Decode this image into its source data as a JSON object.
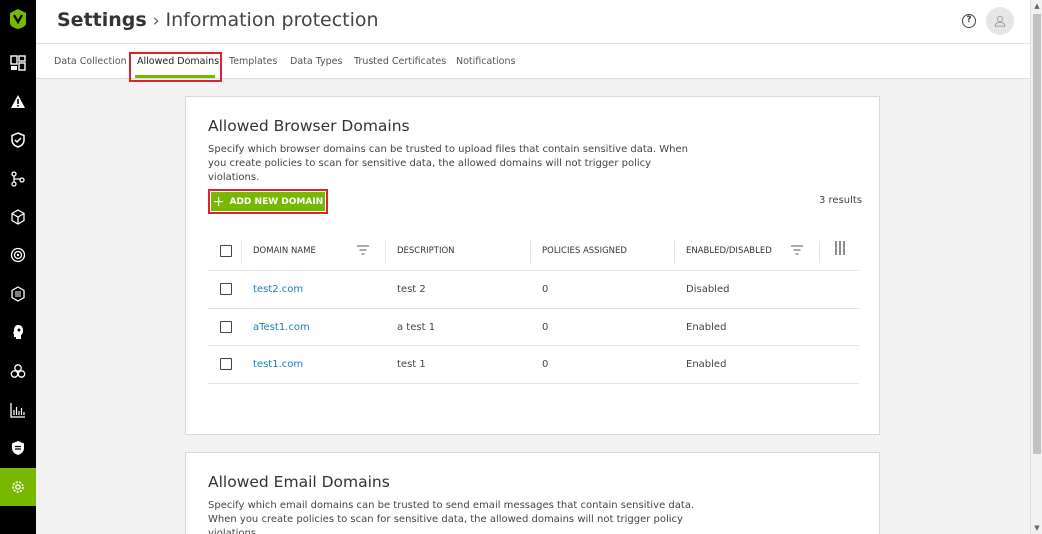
{
  "app": {
    "title_root": "Settings",
    "title_separator": "›",
    "title_page": "Information protection",
    "help_label": "?"
  },
  "nav_rail": {
    "items": [
      {
        "name": "dashboard-icon"
      },
      {
        "name": "alert-icon"
      },
      {
        "name": "shield-check-icon"
      },
      {
        "name": "network-icon"
      },
      {
        "name": "cube-icon"
      },
      {
        "name": "target-icon"
      },
      {
        "name": "api-icon"
      },
      {
        "name": "profile-icon"
      },
      {
        "name": "biohazard-icon"
      },
      {
        "name": "analytics-icon"
      },
      {
        "name": "shield-list-icon"
      },
      {
        "name": "settings-icon",
        "active": true
      }
    ],
    "active_color": "#76b900"
  },
  "tabs": [
    {
      "label": "Data Collection"
    },
    {
      "label": "Allowed Domains",
      "active": true
    },
    {
      "label": "Templates"
    },
    {
      "label": "Data Types"
    },
    {
      "label": "Trusted Certificates"
    },
    {
      "label": "Notifications"
    }
  ],
  "browser_domains": {
    "title": "Allowed Browser Domains",
    "description": "Specify which browser domains can be trusted to upload files that contain sensitive data. When you create policies to scan for sensitive data, the allowed domains will not trigger policy violations.",
    "add_button": {
      "plus": "+",
      "label": "ADD NEW DOMAIN"
    },
    "results": "3 results",
    "columns": {
      "domain": "DOMAIN NAME",
      "description": "DESCRIPTION",
      "policies": "POLICIES ASSIGNED",
      "status": "ENABLED/DISABLED"
    },
    "rows": [
      {
        "domain": "test2.com",
        "description": "test 2",
        "policies": "0",
        "status": "Disabled"
      },
      {
        "domain": "aTest1.com",
        "description": "a test 1",
        "policies": "0",
        "status": "Enabled"
      },
      {
        "domain": "test1.com",
        "description": "test 1",
        "policies": "0",
        "status": "Enabled"
      }
    ]
  },
  "email_domains": {
    "title": "Allowed Email Domains",
    "description": "Specify which email domains can be trusted to send email messages that contain sensitive data. When you create policies to scan for sensitive data, the allowed domains will not trigger policy violations."
  },
  "colors": {
    "accent": "#76b900",
    "highlight": "#d9232d",
    "link": "#1a7fb8"
  }
}
